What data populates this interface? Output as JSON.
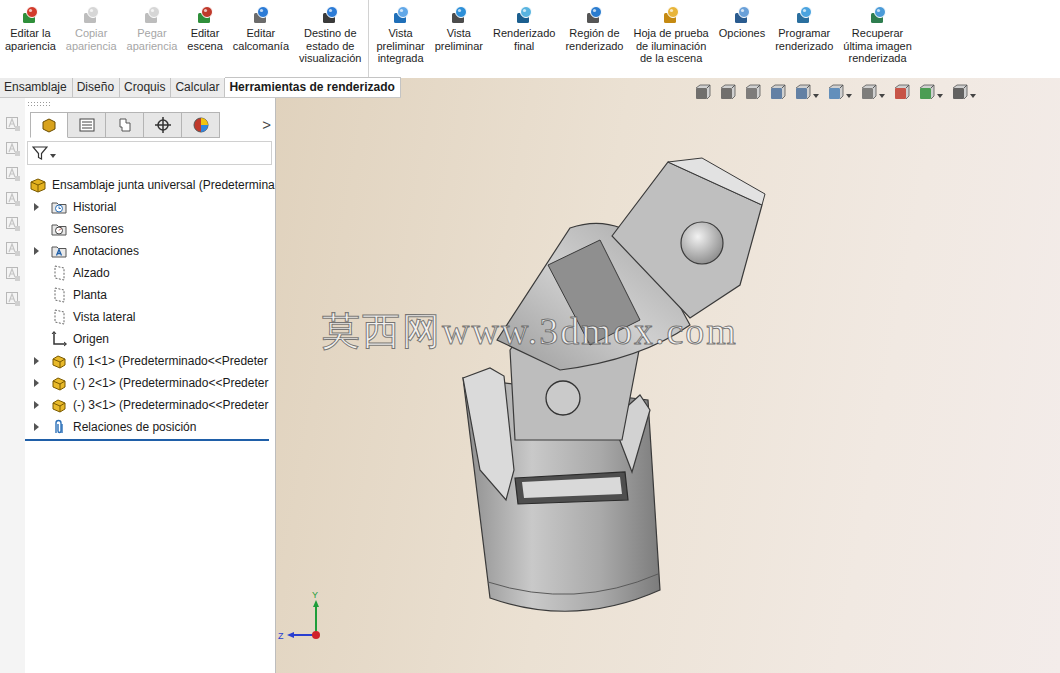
{
  "window": {
    "title": "SolidWorks - Herramientas de renderizado"
  },
  "ribbon": {
    "groups": [
      {
        "buttons": [
          {
            "lines": [
              "Editar la",
              "apariencia"
            ],
            "disabled": false
          },
          {
            "lines": [
              "Copiar",
              "apariencia"
            ],
            "disabled": true
          },
          {
            "lines": [
              "Pegar",
              "apariencia"
            ],
            "disabled": true
          },
          {
            "lines": [
              "Editar",
              "escena"
            ],
            "disabled": false
          },
          {
            "lines": [
              "Editar",
              "calcomanía"
            ],
            "disabled": false
          },
          {
            "lines": [
              "Destino de",
              "estado de",
              "visualización"
            ],
            "disabled": false
          }
        ]
      },
      {
        "buttons": [
          {
            "lines": [
              "Vista",
              "preliminar",
              "integrada"
            ],
            "disabled": false
          },
          {
            "lines": [
              "Vista",
              "preliminar"
            ],
            "disabled": false
          },
          {
            "lines": [
              "Renderizado",
              "final"
            ],
            "disabled": false
          },
          {
            "lines": [
              "Región de",
              "renderizado"
            ],
            "disabled": false
          },
          {
            "lines": [
              "Hoja de prueba",
              "de iluminación",
              "de la escena"
            ],
            "disabled": false
          },
          {
            "lines": [
              "Opciones"
            ],
            "disabled": false
          },
          {
            "lines": [
              "Programar",
              "renderizado"
            ],
            "disabled": false
          },
          {
            "lines": [
              "Recuperar",
              "última imagen",
              "renderizada"
            ],
            "disabled": false
          }
        ]
      }
    ]
  },
  "tabs": [
    {
      "label": "Ensamblaje",
      "selected": false
    },
    {
      "label": "Diseño",
      "selected": false
    },
    {
      "label": "Croquis",
      "selected": false
    },
    {
      "label": "Calcular",
      "selected": false
    },
    {
      "label": "Herramientas de renderizado",
      "selected": true
    }
  ],
  "feature_manager": {
    "panel_tabs": [
      {
        "selected": true
      },
      {
        "selected": false
      },
      {
        "selected": false
      },
      {
        "selected": false
      },
      {
        "selected": false
      }
    ],
    "more": ">",
    "tree": {
      "root": {
        "label": "Ensamblaje junta universal  (Predetermina"
      },
      "items": [
        {
          "label": "Historial",
          "kind": "history",
          "expandable": true
        },
        {
          "label": "Sensores",
          "kind": "sensor",
          "expandable": false
        },
        {
          "label": "Anotaciones",
          "kind": "annotation",
          "expandable": true
        },
        {
          "label": "Alzado",
          "kind": "plane",
          "expandable": false
        },
        {
          "label": "Planta",
          "kind": "plane",
          "expandable": false
        },
        {
          "label": "Vista lateral",
          "kind": "plane",
          "expandable": false
        },
        {
          "label": "Origen",
          "kind": "origin",
          "expandable": false
        },
        {
          "label": "(f) 1<1> (Predeterminado<<Predeter",
          "kind": "part",
          "expandable": true
        },
        {
          "label": "(-) 2<1> (Predeterminado<<Predeter",
          "kind": "part",
          "expandable": true
        },
        {
          "label": "(-) 3<1> (Predeterminado<<Predeter",
          "kind": "part",
          "expandable": true
        },
        {
          "label": "Relaciones de posición",
          "kind": "mates",
          "expandable": true
        }
      ]
    }
  },
  "viewport": {
    "watermark": "莫西网www.3dmox.com",
    "triad": [
      "Y",
      "Z"
    ]
  }
}
